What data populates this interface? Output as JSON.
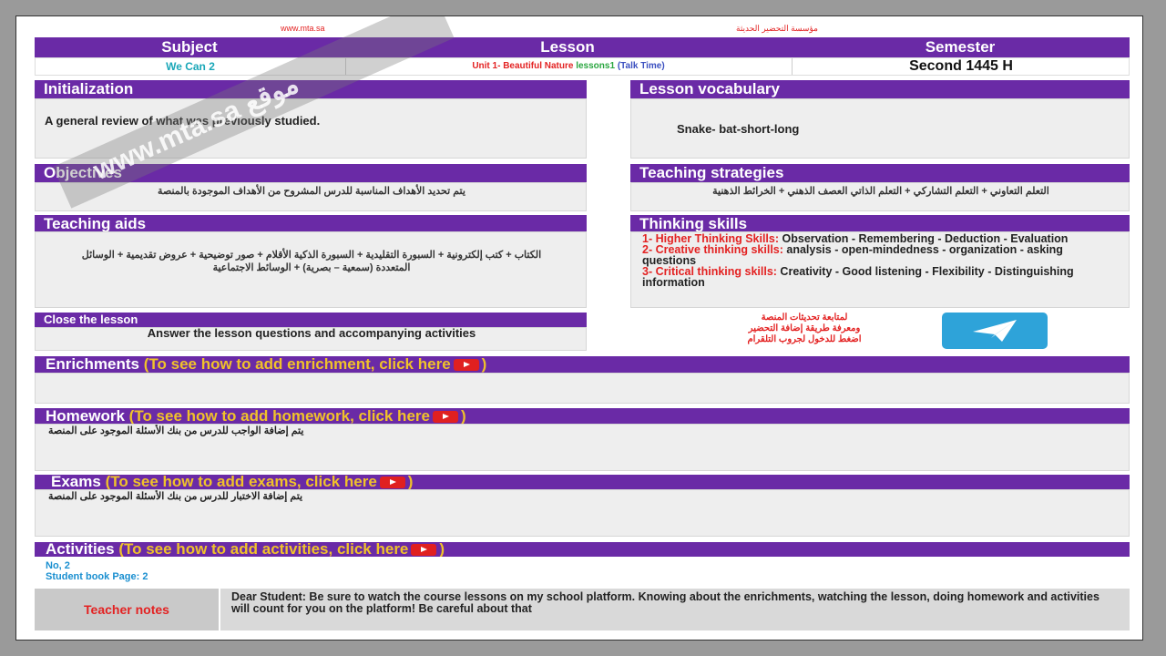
{
  "top": {
    "site": "www.mta.sa",
    "org": "مؤسسة التحضير الحديثة"
  },
  "header": {
    "subject_label": "Subject",
    "lesson_label": "Lesson",
    "semester_label": "Semester",
    "subject_value": "We Can 2",
    "lesson_unit": "Unit 1- Beautiful Nature",
    "lesson_part": "lessons1",
    "lesson_tag": "(Talk Time)",
    "semester_value": "Second 1445 H"
  },
  "initialization": {
    "title": "Initialization",
    "text": "A general review of what was previously studied."
  },
  "vocabulary": {
    "title": "Lesson vocabulary",
    "text": "Snake- bat-short-long"
  },
  "objectives": {
    "title": "Objectives",
    "text": "يتم تحديد الأهداف المناسبة للدرس المشروح من الأهداف الموجودة بالمنصة"
  },
  "strategies": {
    "title": "Teaching strategies",
    "text": "التعلم التعاوني + التعلم التشاركي + التعلم الذاتي العصف الذهني + الخرائط الذهنية"
  },
  "aids": {
    "title": "Teaching aids",
    "text": "الكتاب + كتب إلكترونية + السبورة التقليدية + السبورة الذكية الأقلام + صور توضيحية + عروض تقديمية + الوسائل المتعددة (سمعية – بصرية) + الوسائط الاجتماعية"
  },
  "thinking": {
    "title": "Thinking skills",
    "items": [
      {
        "label": "1- Higher Thinking Skills:",
        "text": " Observation - Remembering - Deduction - Evaluation"
      },
      {
        "label": "2- Creative thinking skills:",
        "text": " analysis - open-mindedness - organization - asking questions"
      },
      {
        "label": "3- Critical thinking skills:",
        "text": " Creativity - Good listening - Flexibility - Distinguishing information"
      }
    ]
  },
  "close": {
    "title": "Close the lesson",
    "text": "Answer the lesson questions and accompanying activities"
  },
  "telegram": {
    "line1": "لمتابعة تحديثات المنصة",
    "line2": "ومعرفة طريقة إضافة التحضير",
    "line3": "اضغط للدخول لجروب التلقرام",
    "icon": "telegram-icon"
  },
  "enrichments": {
    "title": "Enrichments",
    "hint": "(To see how to add enrichment, click here",
    "close": ")"
  },
  "homework": {
    "title": "Homework",
    "hint": "(To see how to add homework, click here",
    "close": ")",
    "text": "يتم إضافة الواجب للدرس من بنك الأسئلة الموجود على المنصة"
  },
  "exams": {
    "title": "Exams",
    "hint": "(To see how to add exams, click here",
    "close": ")",
    "text": "يتم إضافة الاختبار للدرس من بنك الأسئلة الموجود على المنصة"
  },
  "activities": {
    "title": "Activities",
    "hint": "(To see how to add activities, click here",
    "close": ")",
    "line1": "No, 2",
    "line2": "Student book Page: 2"
  },
  "notes": {
    "label": "Teacher notes",
    "text": "Dear Student: Be sure to watch the course lessons on my school platform. Knowing about the enrichments, watching the lesson, doing homework and activities will count for you on the platform! Be careful about that"
  },
  "watermark": "www.mta.sa موقع",
  "colors": {
    "purple": "#6a2aa6",
    "yellow": "#f0c22a",
    "red": "#e32222",
    "teal": "#1aa7b8",
    "green": "#2aa640",
    "telegram": "#2ea3d9"
  }
}
